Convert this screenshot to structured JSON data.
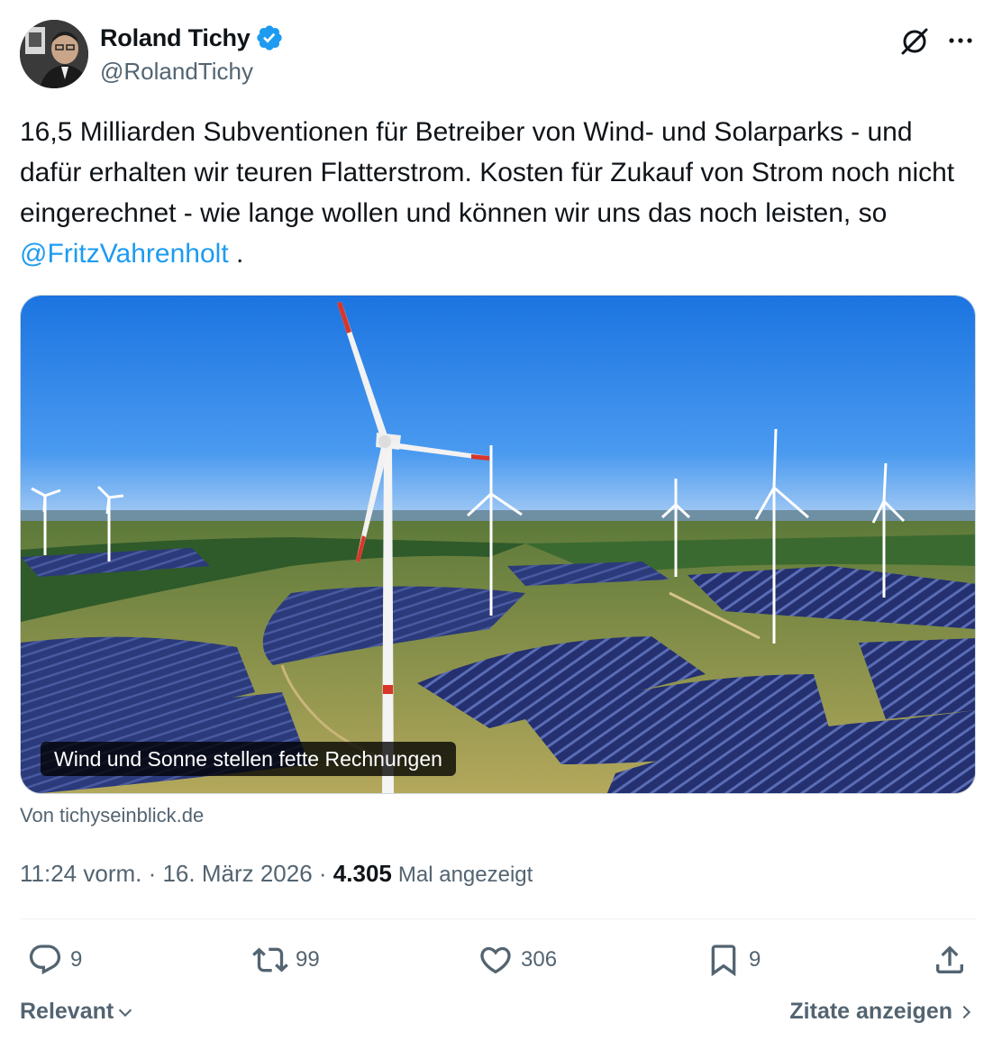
{
  "author": {
    "display_name": "Roland Tichy",
    "handle": "@RolandTichy",
    "verified": true
  },
  "tweet": {
    "text_before_mention": "16,5 Milliarden Subventionen für Betreiber von Wind- und Solarparks - und dafür erhalten wir teuren Flatterstrom. Kosten für Zukauf von Strom noch nicht eingerechnet - wie lange wollen und können wir uns das noch leisten, so",
    "mention": "@FritzVahrenholt",
    "text_after_mention": "."
  },
  "link_card": {
    "title": "Wind und Sonne stellen fette Rechnungen",
    "source": "Von tichyseinblick.de"
  },
  "meta": {
    "time": "11:24 vorm.",
    "separator": " · ",
    "date": "16. März 2026",
    "views_count": "4.305",
    "views_label": "Mal angezeigt"
  },
  "actions": {
    "replies": "9",
    "reposts": "99",
    "likes": "306",
    "bookmarks": "9"
  },
  "footer": {
    "sort_label": "Relevant",
    "quotes_label": "Zitate anzeigen"
  },
  "colors": {
    "accent": "#1d9bf0",
    "text": "#0f1419",
    "secondary": "#536471"
  },
  "icons": [
    "verified-badge-icon",
    "grok-icon",
    "more-icon",
    "reply-icon",
    "repost-icon",
    "like-icon",
    "bookmark-icon",
    "share-icon",
    "chevron-down-icon",
    "chevron-right-icon"
  ]
}
